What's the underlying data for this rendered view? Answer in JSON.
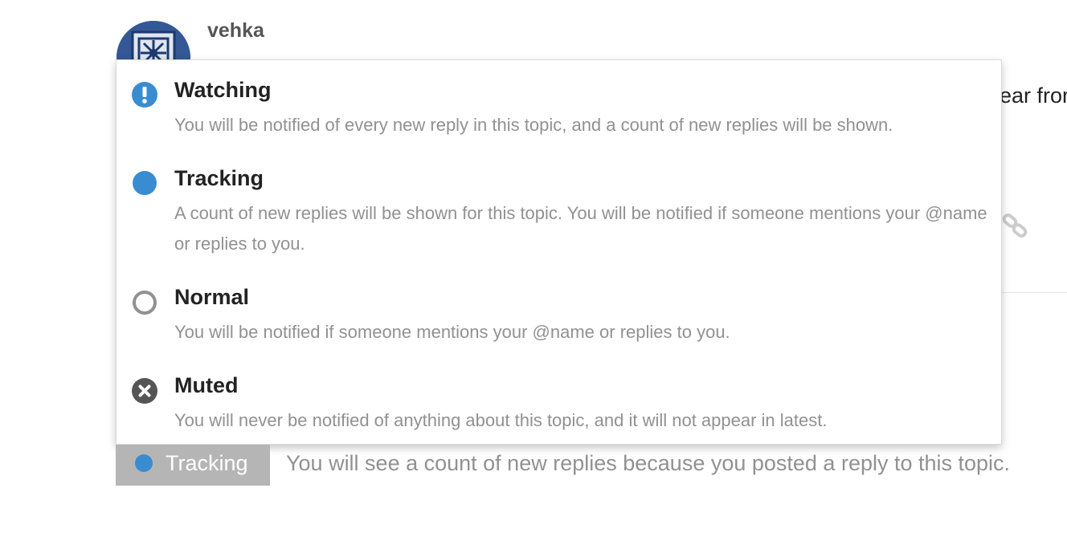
{
  "post": {
    "username": "vehka",
    "partial_text": "ear fror"
  },
  "notification_menu": {
    "options": [
      {
        "title": "Watching",
        "description": "You will be notified of every new reply in this topic, and a count of new replies will be shown.",
        "icon": "exclamation-circle-icon",
        "color": "#3a8cd0"
      },
      {
        "title": "Tracking",
        "description": "A count of new replies will be shown for this topic. You will be notified if someone mentions your @name or replies to you.",
        "icon": "filled-circle-icon",
        "color": "#3a8cd0"
      },
      {
        "title": "Normal",
        "description": "You will be notified if someone mentions your @name or replies to you.",
        "icon": "empty-circle-icon",
        "color": "#919191"
      },
      {
        "title": "Muted",
        "description": "You will never be notified of anything about this topic, and it will not appear in latest.",
        "icon": "x-circle-icon",
        "color": "#555555"
      }
    ]
  },
  "tracking_status": {
    "button_label": "Tracking",
    "reason": "You will see a count of new replies because you posted a reply to this topic."
  },
  "colors": {
    "accent_blue": "#3a8cd0",
    "muted_text": "#919191",
    "button_bg": "#b5b5b5"
  }
}
